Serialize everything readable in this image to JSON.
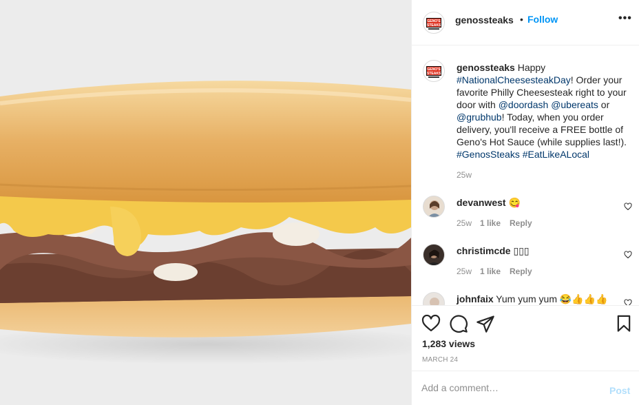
{
  "post": {
    "username": "genossteaks",
    "dot": "•",
    "follow_label": "Follow",
    "more_label": "•••",
    "logo_text": "GENO'S STEAKS",
    "caption": {
      "username": "genossteaks",
      "t1": " Happy ",
      "tag1": "#NationalCheesesteakDay",
      "t2": "! Order your favorite Philly Cheesesteak right to your door with ",
      "m1": "@doordash",
      "t3": " ",
      "m2": "@ubereats",
      "t4": " or ",
      "m3": "@grubhub",
      "t5": "! Today, when you order delivery, you'll receive a FREE bottle of Geno's Hot Sauce (while supplies last!). ",
      "tag2": "#GenosSteaks",
      "t6": " ",
      "tag3": "#EatLikeALocal",
      "time": "25w"
    },
    "comments": [
      {
        "username": "devanwest",
        "text": " 😋",
        "time": "25w",
        "likes": "1 like",
        "reply": "Reply"
      },
      {
        "username": "christimcde",
        "text": " ▯▯▯",
        "time": "25w",
        "likes": "1 like",
        "reply": "Reply"
      },
      {
        "username": "johnfaix",
        "text": " Yum yum yum 😂👍👍👍"
      }
    ],
    "views": "1,283 views",
    "date": "MARCH 24",
    "add_comment_placeholder": "Add a comment…",
    "post_label": "Post",
    "icons": [
      "heart-icon",
      "comment-icon",
      "share-icon",
      "bookmark-icon",
      "more-icon"
    ],
    "colors": {
      "accent": "#0095f6",
      "link": "#00376b",
      "post_disabled": "#b2dffc",
      "muted": "#8e8e8e",
      "logo_red": "#e0311f"
    }
  }
}
